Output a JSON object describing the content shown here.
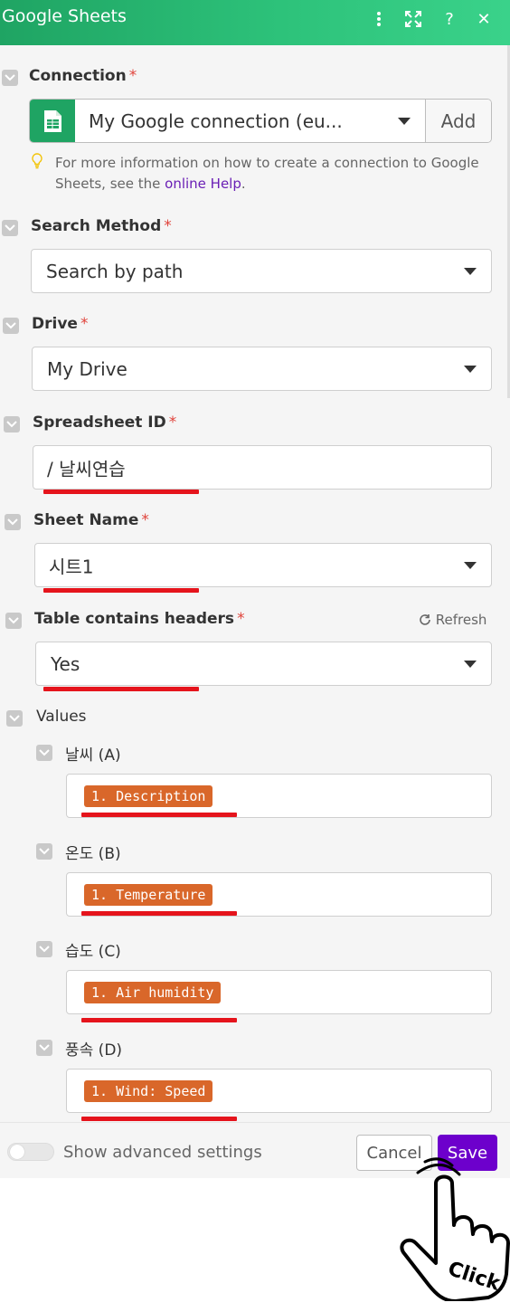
{
  "window": {
    "title": "Google Sheets"
  },
  "header_icons": [
    "more-vertical-icon",
    "expand-icon",
    "help-icon",
    "close-icon"
  ],
  "header_labels": {
    "help": "?",
    "close": "✕"
  },
  "connection": {
    "label": "Connection",
    "required_mark": "*",
    "selected": "My Google connection (eu...",
    "add_label": "Add",
    "help_prefix": "For more information on how to create a connection to Google Sheets, see the",
    "help_link": "online Help",
    "help_suffix": "."
  },
  "search_method": {
    "label": "Search Method",
    "required_mark": "*",
    "value": "Search by path"
  },
  "drive": {
    "label": "Drive",
    "required_mark": "*",
    "value": "My Drive"
  },
  "spreadsheet_id": {
    "label": "Spreadsheet ID",
    "required_mark": "*",
    "value": "/ 날씨연습"
  },
  "sheet_name": {
    "label": "Sheet Name",
    "required_mark": "*",
    "value": "시트1"
  },
  "table_headers": {
    "label": "Table contains headers",
    "required_mark": "*",
    "refresh_label": "Refresh",
    "value": "Yes"
  },
  "values": {
    "label": "Values",
    "items": [
      {
        "label": "날씨 (A)",
        "pill": "1. Description"
      },
      {
        "label": "온도 (B)",
        "pill": "1. Temperature"
      },
      {
        "label": "습도 (C)",
        "pill": "1. Air humidity"
      },
      {
        "label": "풍속 (D)",
        "pill": "1. Wind: Speed"
      }
    ]
  },
  "footer": {
    "advanced_label": "Show advanced settings",
    "cancel_label": "Cancel",
    "save_label": "Save"
  },
  "annotation": {
    "click_label": "Click"
  },
  "colors": {
    "header": "#2dc27a",
    "required": "#e0433b",
    "pill": "#d9672a",
    "save": "#6d00cc",
    "underline": "#e5141c",
    "link": "#6a1fb5"
  }
}
